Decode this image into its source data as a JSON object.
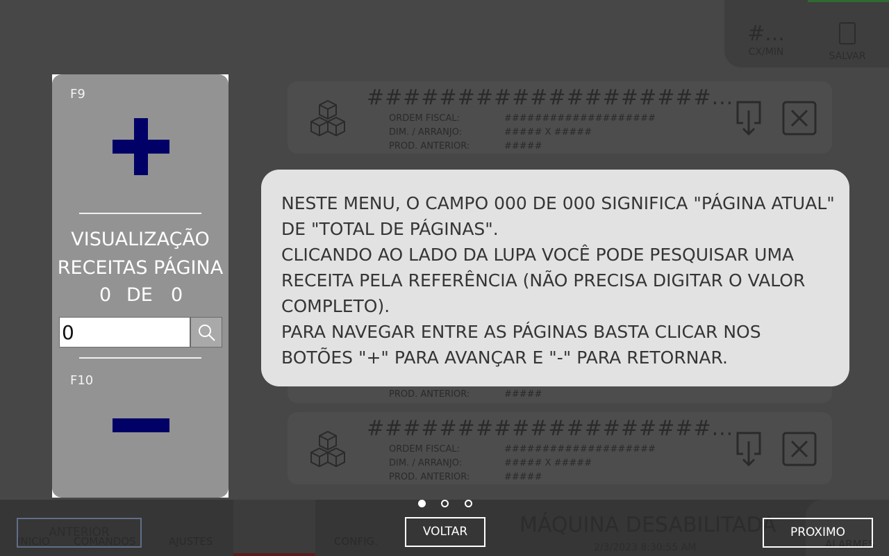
{
  "background": {
    "stats": [
      {
        "value": "#...",
        "label": "CX/MIN"
      },
      {
        "value": "",
        "label": "SALVAR"
      }
    ],
    "recipe_cards": [
      {
        "title": "###################...",
        "rows": [
          {
            "label": "ORDEM FISCAL:",
            "value": "####################"
          },
          {
            "label": "DIM. / ARRANJO:",
            "value": "##### X #####"
          },
          {
            "label": "PROD. ANTERIOR:",
            "value": "#####"
          }
        ]
      },
      {
        "title": "###################...",
        "rows": [
          {
            "label": "PROD. ANTERIOR:",
            "value": "#####"
          }
        ]
      },
      {
        "title": "###################...",
        "rows": [
          {
            "label": "ORDEM FISCAL:",
            "value": "####################"
          },
          {
            "label": "DIM. / ARRANJO:",
            "value": "##### X #####"
          },
          {
            "label": "PROD. ANTERIOR:",
            "value": "#####"
          }
        ]
      }
    ],
    "bottom_nav": [
      "INICIO",
      "COMANDOS",
      "AJUSTES",
      "",
      "CONFIG."
    ],
    "status": "MÁQUINA DESABILITADA",
    "date": "2/3/2023 8:30:55 AM",
    "alarm": "ALARMES"
  },
  "pager": {
    "f9": "F9",
    "f10": "F10",
    "title_line1": "VISUALIZAÇÃO",
    "title_line2": "RECEITAS PÁGINA",
    "current_page": "0",
    "of": "DE",
    "total_pages": "0",
    "search_value": "0"
  },
  "tooltip": {
    "text": "NESTE MENU, O CAMPO 000 DE 000 SIGNIFICA \"PÁGINA ATUAL\" DE \"TOTAL DE PÁGINAS\".\nCLICANDO AO LADO DA LUPA VOCÊ PODE PESQUISAR UMA RECEITA PELA REFERÊNCIA (NÃO PRECISA DIGITAR O VALOR COMPLETO).\nPARA NAVEGAR ENTRE AS PÁGINAS BASTA CLICAR NOS BOTÕES \"+\" PARA AVANÇAR E \"-\" PARA RETORNAR."
  },
  "tutorial": {
    "prev_label": "ANTERIOR",
    "back_label": "VOLTAR",
    "next_label": "PROXIMO",
    "step_dots": [
      {
        "active": true
      },
      {
        "active": false
      },
      {
        "active": false
      }
    ]
  }
}
